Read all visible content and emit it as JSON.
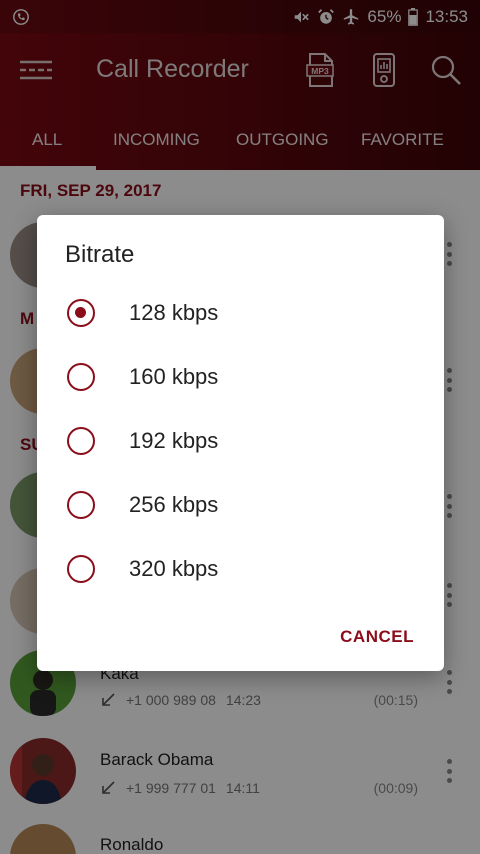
{
  "status_bar": {
    "battery": "65%",
    "time": "13:53",
    "icons": [
      "call-recorder-notification-icon",
      "mute-icon",
      "alarm-icon",
      "airplane-icon",
      "battery-icon"
    ]
  },
  "app_bar": {
    "title": "Call Recorder",
    "mp3_label": "MP3",
    "icons": [
      "menu-icon",
      "mp3-file-icon",
      "recorder-device-icon",
      "search-icon"
    ]
  },
  "tabs": [
    {
      "label": "ALL",
      "selected": true
    },
    {
      "label": "INCOMING",
      "selected": false
    },
    {
      "label": "OUTGOING",
      "selected": false
    },
    {
      "label": "FAVORITE",
      "selected": false
    }
  ],
  "list": {
    "section_date": "FRI, SEP 29, 2017",
    "section_2_partial": "M",
    "section_3_partial": "SU",
    "rows": [
      {
        "name": "Kaka",
        "number": "+1 000 989 08",
        "time": "14:23",
        "duration": "(00:15)"
      },
      {
        "name": "Barack Obama",
        "number": "+1 999 777 01",
        "time": "14:11",
        "duration": "(00:09)"
      },
      {
        "name": "Ronaldo"
      }
    ]
  },
  "dialog": {
    "title": "Bitrate",
    "options": [
      {
        "label": "128 kbps",
        "selected": true
      },
      {
        "label": "160 kbps",
        "selected": false
      },
      {
        "label": "192 kbps",
        "selected": false
      },
      {
        "label": "256 kbps",
        "selected": false
      },
      {
        "label": "320 kbps",
        "selected": false
      }
    ],
    "cancel_label": "CANCEL"
  },
  "colors": {
    "brand": "#7a0a12",
    "accent": "#8b0d1a"
  }
}
